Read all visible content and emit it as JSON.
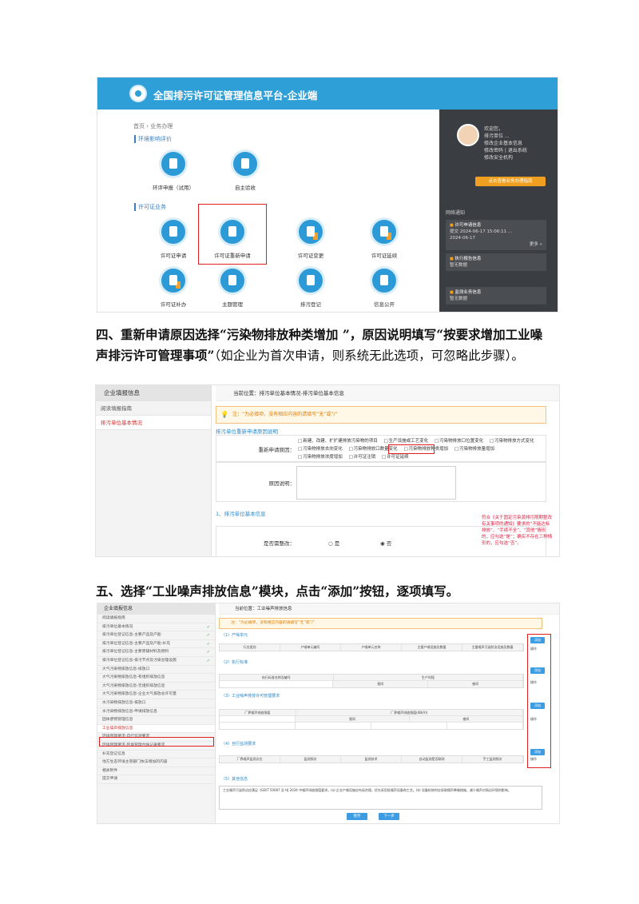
{
  "screenshot1": {
    "platform_title": "全国排污许可证管理信息平台-企业端",
    "breadcrumb": "首页 › 业务办理",
    "section_env": "环境影响评价",
    "section_permit": "许可证业务",
    "tiles_env": [
      "环评申报（试用）",
      "自主验收"
    ],
    "tiles_permit_row1": [
      "许可证申请",
      "许可证重新申请",
      "许可证变更",
      "许可证延续"
    ],
    "tiles_permit_row2": [
      "许可证补办",
      "主题管理",
      "排污登记",
      "信息公开"
    ],
    "side_welcome": "欢迎您，",
    "side_links": [
      "排污单位 ...",
      "修改企业基本信息",
      "修改密码 | 退出系统",
      "修改安全机构"
    ],
    "side_button": "点击查看业务办理指南",
    "side_notice_title": "网络通知",
    "side_cards": [
      {
        "title": "许可申请信息",
        "lines": [
          "提交 2024-06-17 15:06:11 ...",
          "2024-06-17",
          "更多 »"
        ]
      },
      {
        "title": "执行报告信息",
        "lines": [
          "暂无数据"
        ]
      },
      {
        "title": "监测业务信息",
        "lines": [
          "暂无数据"
        ]
      }
    ]
  },
  "paragraph4": {
    "bold": "四、重新申请原因选择“污染物排放种类增加 ”，原因说明填写“按要求增加工业噪声排污许可管理事项”",
    "note": "（如企业为首次申请，则系统无此选项，可忽略此步骤）。"
  },
  "screenshot2": {
    "left_header": "企业填报信息",
    "left_items": [
      "阅读填报指南",
      "排污单位基本情况"
    ],
    "location": "当前位置：排污单位基本情况-排污单位基本信息",
    "tip": "注：“为必填项，没有相应内容的请填写“无”或“/”",
    "reason_section": "排污单位重新申请原因说明",
    "reason_label": "重新申请原因：",
    "reason_options": [
      "新建、改建、扩扩建排放污染物的项目",
      "生产设施或工艺变化",
      "污染物排放口位置变化",
      "污染物排放方式变化",
      "污染物排放去向变化",
      "污染物排放口数量变化",
      "污染物排放种类增加",
      "污染物排放量增加",
      "污染物排放浓度增加",
      "许可证注销",
      "许可证延续"
    ],
    "explain_label": "原因说明：",
    "basic_section": "1、排污单位基本信息",
    "relocate_label": "是否需整改：",
    "radio_yes": "是",
    "radio_no": "否",
    "hint": "符合《关于固定污染源排污限期整改有关事项的通知》要求的“不能达标排放”、“手续不全”、“其他”情形的，应勾选“是”；确实不存在三种情形的，应勾选“否”。"
  },
  "paragraph5": {
    "bold": "五、选择“工业噪声排放信息”模块，点击“添加”按钮，逐项填写。"
  },
  "screenshot3": {
    "left_header": "企业填报信息",
    "left_items": [
      {
        "label": "阅读填报指南",
        "ok": false
      },
      {
        "label": "排污单位基本情况",
        "ok": true
      },
      {
        "label": "排污单位登记信息-主要产品及产能",
        "ok": true
      },
      {
        "label": "排污单位登记信息-主要产品及产能-补充",
        "ok": true
      },
      {
        "label": "排污单位登记信息-主要原辅材料及燃料",
        "ok": true
      },
      {
        "label": "排污单位登记信息-排污节点及污染治理设施",
        "ok": true
      },
      {
        "label": "大气污染物排放信息-排放口",
        "ok": false
      },
      {
        "label": "大气污染物排放信息-有组织排放信息",
        "ok": false
      },
      {
        "label": "大气污染物排放信息-无组织排放信息",
        "ok": false
      },
      {
        "label": "大气污染物排放信息-企业大气排放总许可量",
        "ok": false
      },
      {
        "label": "水污染物排放信息-排放口",
        "ok": false
      },
      {
        "label": "水污染物排放信息-申请排放信息",
        "ok": false
      },
      {
        "label": "固体废物管理信息",
        "ok": false
      },
      {
        "label": "工业噪声排放信息",
        "ok": false
      },
      {
        "label": "环境管理要求-自行监测要求",
        "ok": false
      },
      {
        "label": "环境管理要求-环境管理台账记录要求",
        "ok": false
      },
      {
        "label": "补充登记信息",
        "ok": false
      },
      {
        "label": "地方生态环境主管部门依法增加的内容",
        "ok": false
      },
      {
        "label": "相关附件",
        "ok": false
      },
      {
        "label": "提交申请",
        "ok": false
      }
    ],
    "location": "当前位置：工业噪声排放信息",
    "tip": "注：“为必填项，没有相应内容的请填写“无”或“/”",
    "add_label": "添加",
    "op_label": "操作",
    "sections": [
      {
        "title": "（1）产噪单元",
        "headers": [
          "行业类别",
          "产噪单元编号",
          "产噪单元名称",
          "主要产噪设施及数量",
          "主要噪声污染防治设施及数量"
        ]
      },
      {
        "title": "（2）执行标准",
        "headers": [
          "执行标准名称及编号",
          "生产时段"
        ],
        "subheaders": [
          "昼间",
          "夜间"
        ]
      },
      {
        "title": "（3）工业噪声排放许可管理要求",
        "headers": [
          "厂界噪声排放限值",
          "厂界噪声排放限值(dB(A))"
        ],
        "subheaders": [
          "昼间",
          "夜间"
        ]
      },
      {
        "title": "（4）自行监测要求",
        "headers": [
          "厂界噪声监测点位",
          "监测频次",
          "监测技术",
          "自动监测是否联网",
          "手工监测频次"
        ]
      },
      {
        "title": "（5）其他信息",
        "headers": []
      }
    ],
    "other_text": "工业噪声污染防治应满足《GB/T 50087 及 HJ 2034 中噪声排放限值要求。(a) 企业产噪设施应布局合理，优先采用低噪声设备和工艺。(b) 设备检修时应采取隔声降噪措施，减少噪声对周边环境的影响。",
    "buttons": [
      "暂存",
      "下一步"
    ]
  }
}
